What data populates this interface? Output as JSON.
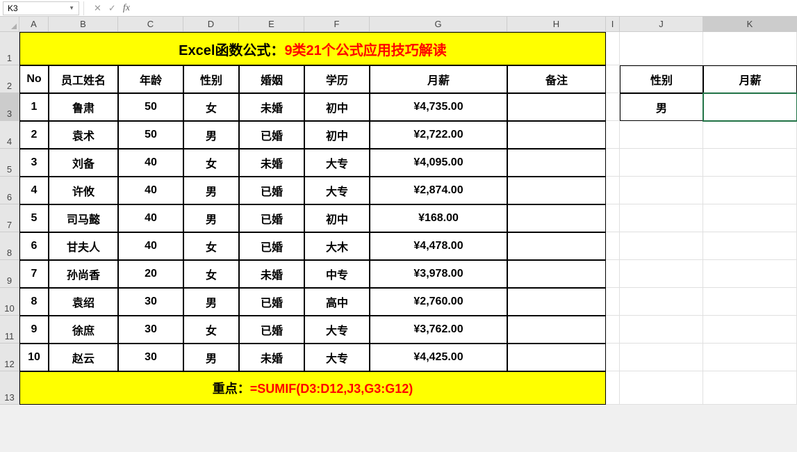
{
  "nameBox": "K3",
  "formulaBar": "",
  "columns": [
    "A",
    "B",
    "C",
    "D",
    "E",
    "F",
    "G",
    "H",
    "I",
    "J",
    "K"
  ],
  "rowNumbers": [
    1,
    2,
    3,
    4,
    5,
    6,
    7,
    8,
    9,
    10,
    11,
    12,
    13
  ],
  "selectedCell": {
    "col": "K",
    "row": 3
  },
  "title": {
    "part1": "Excel函数公式：",
    "part2": "9类21个公式应用技巧解读"
  },
  "headers": {
    "A": "No",
    "B": "员工姓名",
    "C": "年龄",
    "D": "性别",
    "E": "婚姻",
    "F": "学历",
    "G": "月薪",
    "H": "备注",
    "J": "性别",
    "K": "月薪"
  },
  "sideData": {
    "J3": "男",
    "K3": ""
  },
  "rows": [
    {
      "no": "1",
      "name": "鲁肃",
      "age": "50",
      "sex": "女",
      "marriage": "未婚",
      "edu": "初中",
      "salary": "¥4,735.00",
      "note": ""
    },
    {
      "no": "2",
      "name": "袁术",
      "age": "50",
      "sex": "男",
      "marriage": "已婚",
      "edu": "初中",
      "salary": "¥2,722.00",
      "note": ""
    },
    {
      "no": "3",
      "name": "刘备",
      "age": "40",
      "sex": "女",
      "marriage": "未婚",
      "edu": "大专",
      "salary": "¥4,095.00",
      "note": ""
    },
    {
      "no": "4",
      "name": "许攸",
      "age": "40",
      "sex": "男",
      "marriage": "已婚",
      "edu": "大专",
      "salary": "¥2,874.00",
      "note": ""
    },
    {
      "no": "5",
      "name": "司马懿",
      "age": "40",
      "sex": "男",
      "marriage": "已婚",
      "edu": "初中",
      "salary": "¥168.00",
      "note": ""
    },
    {
      "no": "6",
      "name": "甘夫人",
      "age": "40",
      "sex": "女",
      "marriage": "已婚",
      "edu": "大木",
      "salary": "¥4,478.00",
      "note": ""
    },
    {
      "no": "7",
      "name": "孙尚香",
      "age": "20",
      "sex": "女",
      "marriage": "未婚",
      "edu": "中专",
      "salary": "¥3,978.00",
      "note": ""
    },
    {
      "no": "8",
      "name": "袁绍",
      "age": "30",
      "sex": "男",
      "marriage": "已婚",
      "edu": "高中",
      "salary": "¥2,760.00",
      "note": ""
    },
    {
      "no": "9",
      "name": "徐庶",
      "age": "30",
      "sex": "女",
      "marriage": "已婚",
      "edu": "大专",
      "salary": "¥3,762.00",
      "note": ""
    },
    {
      "no": "10",
      "name": "赵云",
      "age": "30",
      "sex": "男",
      "marriage": "未婚",
      "edu": "大专",
      "salary": "¥4,425.00",
      "note": ""
    }
  ],
  "footer": {
    "label": "重点：",
    "formula": "=SUMIF(D3:D12,J3,G3:G12)"
  },
  "chart_data": {
    "type": "table",
    "title": "Excel函数公式：9类21个公式应用技巧解读",
    "columns": [
      "No",
      "员工姓名",
      "年龄",
      "性别",
      "婚姻",
      "学历",
      "月薪",
      "备注"
    ],
    "data": [
      [
        1,
        "鲁肃",
        50,
        "女",
        "未婚",
        "初中",
        4735.0,
        ""
      ],
      [
        2,
        "袁术",
        50,
        "男",
        "已婚",
        "初中",
        2722.0,
        ""
      ],
      [
        3,
        "刘备",
        40,
        "女",
        "未婚",
        "大专",
        4095.0,
        ""
      ],
      [
        4,
        "许攸",
        40,
        "男",
        "已婚",
        "大专",
        2874.0,
        ""
      ],
      [
        5,
        "司马懿",
        40,
        "男",
        "已婚",
        "初中",
        168.0,
        ""
      ],
      [
        6,
        "甘夫人",
        40,
        "女",
        "已婚",
        "大木",
        4478.0,
        ""
      ],
      [
        7,
        "孙尚香",
        20,
        "女",
        "未婚",
        "中专",
        3978.0,
        ""
      ],
      [
        8,
        "袁绍",
        30,
        "男",
        "已婚",
        "高中",
        2760.0,
        ""
      ],
      [
        9,
        "徐庶",
        30,
        "女",
        "已婚",
        "大专",
        3762.0,
        ""
      ],
      [
        10,
        "赵云",
        30,
        "男",
        "未婚",
        "大专",
        4425.0,
        ""
      ]
    ],
    "side_table": {
      "性别": "男",
      "月薪": null
    },
    "formula": "=SUMIF(D3:D12,J3,G3:G12)"
  }
}
